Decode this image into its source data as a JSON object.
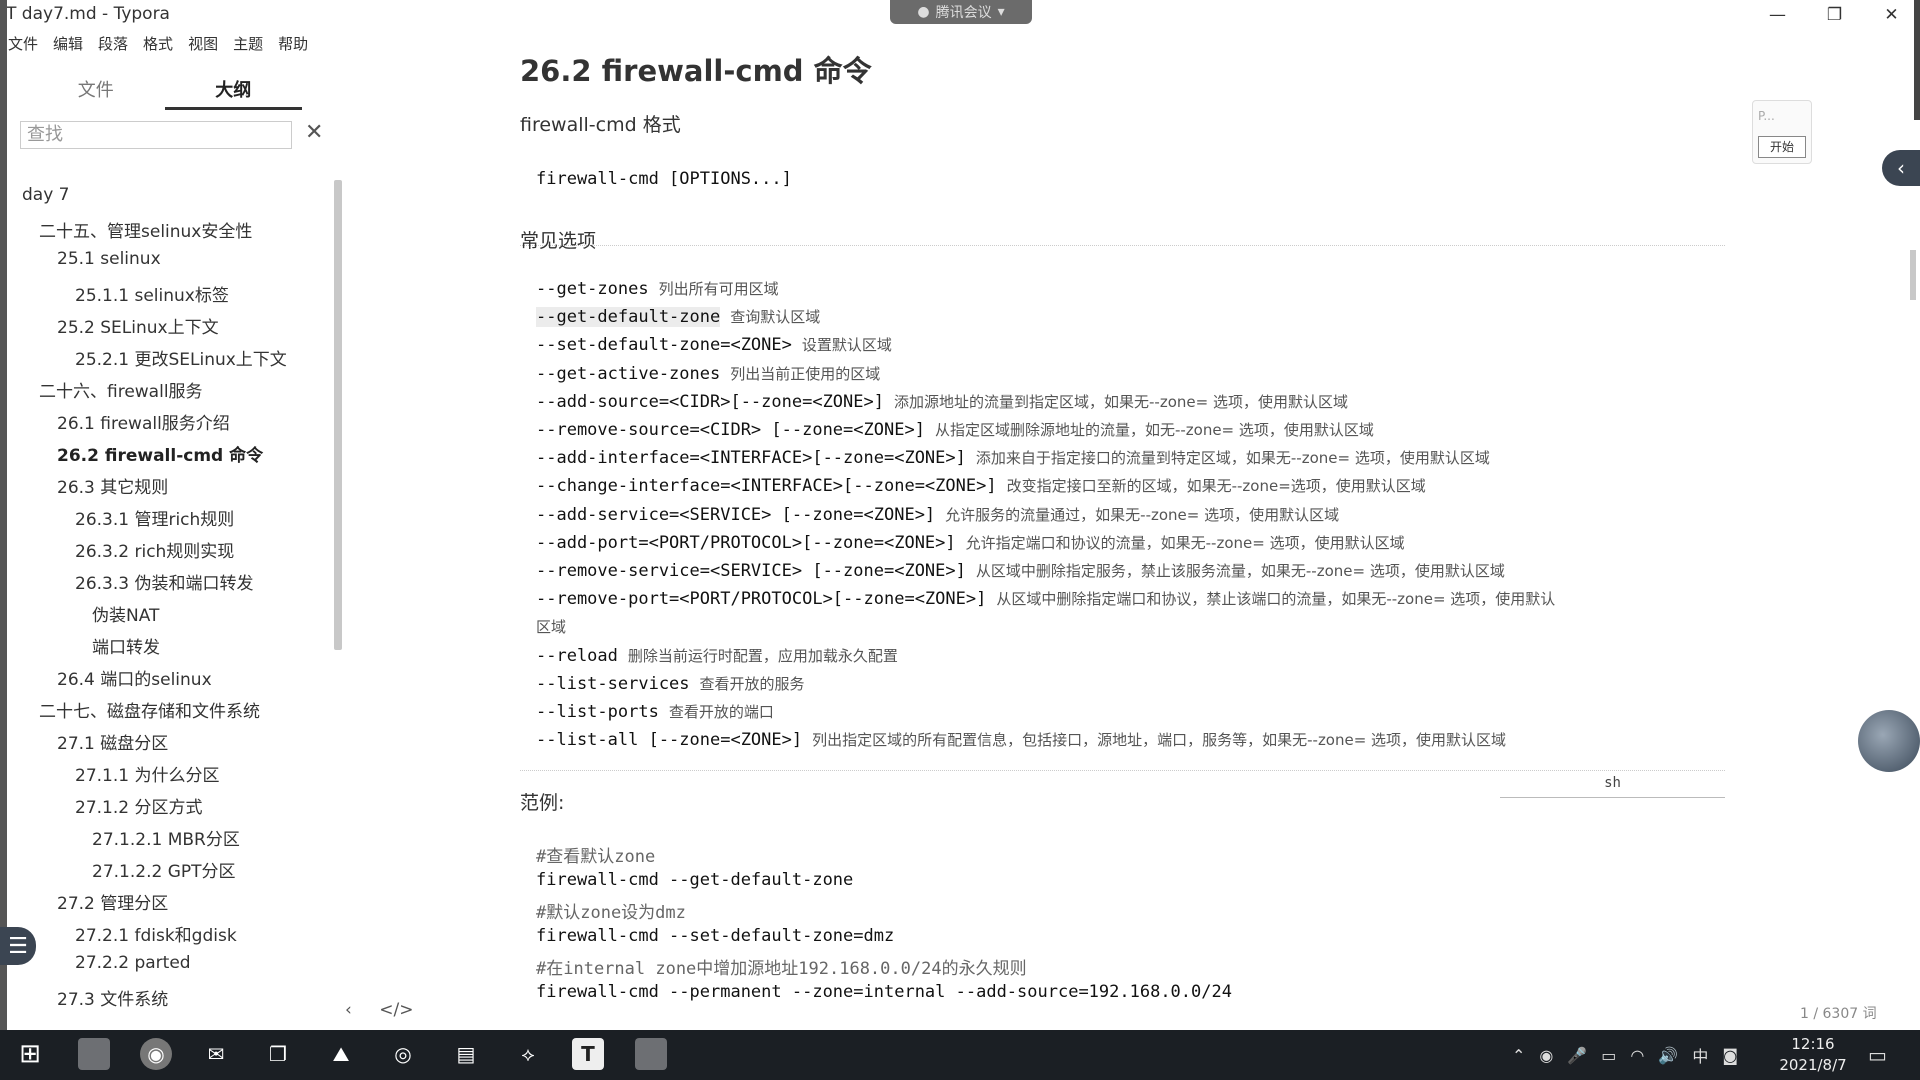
{
  "window": {
    "title": "day7.md - Typora",
    "app_glyph": "T",
    "minimize": "—",
    "restore": "❐",
    "close": "✕",
    "meeting": "腾讯会议"
  },
  "menu": [
    "文件",
    "编辑",
    "段落",
    "格式",
    "视图",
    "主题",
    "帮助"
  ],
  "sidebar": {
    "tabs": [
      "文件",
      "大纲"
    ],
    "active_tab": "大纲",
    "search_placeholder": "查找",
    "outline": [
      {
        "label": "day 7",
        "level": 0
      },
      {
        "label": "二十五、管理selinux安全性",
        "level": 1
      },
      {
        "label": "25.1 selinux",
        "level": 2
      },
      {
        "label": "25.1.1 selinux标签",
        "level": 3
      },
      {
        "label": "25.2 SELinux上下文",
        "level": 2
      },
      {
        "label": "25.2.1 更改SELinux上下文",
        "level": 3
      },
      {
        "label": "二十六、firewall服务",
        "level": 1
      },
      {
        "label": "26.1 firewall服务介绍",
        "level": 2
      },
      {
        "label": "26.2 firewall-cmd 命令",
        "level": 2,
        "active": true
      },
      {
        "label": "26.3 其它规则",
        "level": 2
      },
      {
        "label": "26.3.1 管理rich规则",
        "level": 3
      },
      {
        "label": "26.3.2 rich规则实现",
        "level": 3
      },
      {
        "label": "26.3.3 伪装和端口转发",
        "level": 3
      },
      {
        "label": "伪装NAT",
        "level": 4
      },
      {
        "label": "端口转发",
        "level": 4
      },
      {
        "label": "26.4 端口的selinux",
        "level": 2
      },
      {
        "label": "二十七、磁盘存储和文件系统",
        "level": 1
      },
      {
        "label": "27.1 磁盘分区",
        "level": 2
      },
      {
        "label": "27.1.1 为什么分区",
        "level": 3
      },
      {
        "label": "27.1.2 分区方式",
        "level": 3
      },
      {
        "label": "27.1.2.1 MBR分区",
        "level": 4
      },
      {
        "label": "27.1.2.2 GPT分区",
        "level": 4
      },
      {
        "label": "27.2 管理分区",
        "level": 2
      },
      {
        "label": "27.2.1 fdisk和gdisk",
        "level": 3
      },
      {
        "label": "27.2.2 parted",
        "level": 3
      },
      {
        "label": "27.3 文件系统",
        "level": 2
      }
    ],
    "bottom_prev": "‹",
    "bottom_code": "</>"
  },
  "doc": {
    "heading": "26.2 firewall-cmd 命令",
    "format_label": "firewall-cmd 格式",
    "format_code": "firewall-cmd [OPTIONS...]",
    "options_title": "常见选项",
    "options": [
      {
        "cmd": "--get-zones",
        "desc": "列出所有可用区域"
      },
      {
        "cmd": "--get-default-zone",
        "desc": "查询默认区域"
      },
      {
        "cmd": "--set-default-zone=<ZONE>",
        "desc": "设置默认区域"
      },
      {
        "cmd": "--get-active-zones",
        "desc": "列出当前正使用的区域"
      },
      {
        "cmd": "--add-source=<CIDR>[--zone=<ZONE>]",
        "desc": "添加源地址的流量到指定区域，如果无--zone= 选项，使用默认区域"
      },
      {
        "cmd": "--remove-source=<CIDR> [--zone=<ZONE>]",
        "desc": "从指定区域删除源地址的流量，如无--zone= 选项，使用默认区域"
      },
      {
        "cmd": "--add-interface=<INTERFACE>[--zone=<ZONE>]",
        "desc": "添加来自于指定接口的流量到特定区域，如果无--zone= 选项，使用默认区域"
      },
      {
        "cmd": "--change-interface=<INTERFACE>[--zone=<ZONE>]",
        "desc": "改变指定接口至新的区域，如果无--zone=选项，使用默认区域"
      },
      {
        "cmd": "--add-service=<SERVICE> [--zone=<ZONE>]",
        "desc": "允许服务的流量通过，如果无--zone= 选项，使用默认区域"
      },
      {
        "cmd": "--add-port=<PORT/PROTOCOL>[--zone=<ZONE>]",
        "desc": "允许指定端口和协议的流量，如果无--zone= 选项，使用默认区域"
      },
      {
        "cmd": "--remove-service=<SERVICE> [--zone=<ZONE>]",
        "desc": "从区域中删除指定服务，禁止该服务流量，如果无--zone= 选项，使用默认区域"
      },
      {
        "cmd": "--remove-port=<PORT/PROTOCOL>[--zone=<ZONE>]",
        "desc": "从区域中删除指定端口和协议，禁止该端口的流量，如果无--zone= 选项，使用默认"
      },
      {
        "cmd": "",
        "desc": "区域"
      },
      {
        "cmd": "--reload",
        "desc": "删除当前运行时配置，应用加载永久配置"
      },
      {
        "cmd": "--list-services",
        "desc": "查看开放的服务"
      },
      {
        "cmd": "--list-ports",
        "desc": "查看开放的端口"
      },
      {
        "cmd": "--list-all [--zone=<ZONE>]",
        "desc": "列出指定区域的所有配置信息，包括接口，源地址，端口，服务等，如果无--zone= 选项，使用默认区域"
      }
    ],
    "example_title": "范例:",
    "lang_tag": "sh",
    "example_lines": [
      {
        "text": "#查看默认zone",
        "comment": true
      },
      {
        "text": "firewall-cmd --get-default-zone",
        "comment": false
      },
      {
        "text": "#默认zone设为dmz",
        "comment": true
      },
      {
        "text": "firewall-cmd --set-default-zone=dmz",
        "comment": false
      },
      {
        "text": "#在internal zone中增加源地址192.168.0.0/24的永久规则",
        "comment": true
      },
      {
        "text": "firewall-cmd --permanent --zone=internal --add-source=192.168.0.0/24",
        "comment": false
      }
    ]
  },
  "word_count": "1 / 6307 词",
  "float_panel": {
    "label": "P...",
    "button": "开始"
  },
  "taskbar": {
    "time": "12:16",
    "date": "2021/8/7",
    "ime": "中"
  }
}
